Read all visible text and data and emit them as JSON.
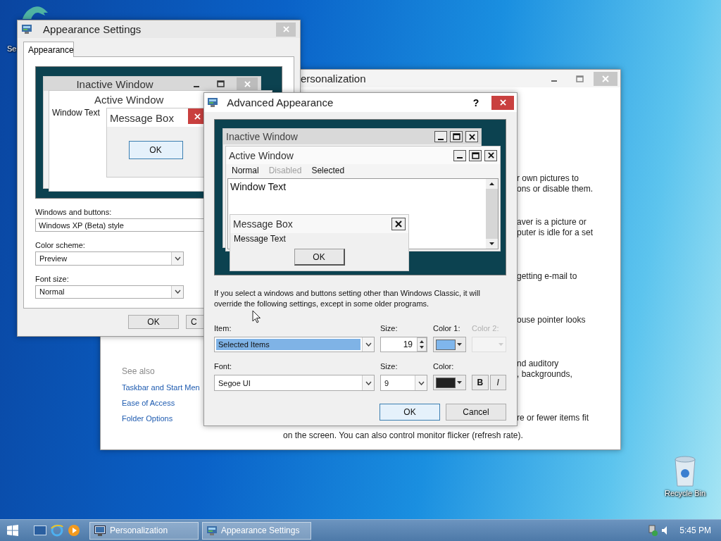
{
  "desktop": {
    "icons": [
      {
        "label": "Se",
        "kind": "dragon"
      },
      {
        "label": "Recycle Bin",
        "kind": "bin"
      }
    ]
  },
  "personalization": {
    "title": "ersonalization",
    "see_also": {
      "heading": "See also",
      "links": [
        "Taskbar and Start Men",
        "Ease of Access",
        "Folder Options"
      ]
    },
    "fragments": [
      [
        "r own pictures to",
        "ons or disable them."
      ],
      [
        "aver is a picture or",
        "puter is idle for a set"
      ],
      [
        "getting e-mail to"
      ],
      [
        "ouse pointer looks"
      ],
      [
        "nd auditory",
        ", backgrounds,"
      ],
      [
        "re or fewer items fit"
      ]
    ],
    "last_line": "on the screen. You can also control monitor flicker (refresh rate)."
  },
  "appearance_settings": {
    "title": "Appearance Settings",
    "tabs": [
      {
        "label": "Appearance",
        "selected": true
      }
    ],
    "preview": {
      "inactive_title": "Inactive Window",
      "active_title": "Active Window",
      "window_text": "Window Text",
      "message_box_title": "Message Box",
      "ok": "OK"
    },
    "fields": [
      {
        "label": "Windows and buttons:",
        "value": "Windows XP (Beta) style",
        "kind": "text"
      },
      {
        "label": "Color scheme:",
        "value": "Preview",
        "kind": "dropdown"
      },
      {
        "label": "Font size:",
        "value": "Normal",
        "kind": "dropdown"
      }
    ],
    "buttons": [
      "OK",
      "C"
    ]
  },
  "advanced_appearance": {
    "title": "Advanced Appearance",
    "help": "?",
    "preview": {
      "inactive_title": "Inactive Window",
      "active_title": "Active Window",
      "menu": [
        {
          "label": "Normal",
          "disabled": false
        },
        {
          "label": "Disabled",
          "disabled": true
        },
        {
          "label": "Selected",
          "disabled": false
        }
      ],
      "window_text": "Window Text",
      "message_box_title": "Message Box",
      "message_text": "Message Text",
      "ok": "OK"
    },
    "note": "If you select a windows and buttons setting other than Windows Classic, it will override the following settings, except in some older programs.",
    "item": {
      "label": "Item:",
      "value": "Selected Items"
    },
    "item_size": {
      "label": "Size:",
      "value": "19"
    },
    "color1": {
      "label": "Color 1:",
      "color": "#7fb6ec",
      "disabled": false
    },
    "color2": {
      "label": "Color 2:",
      "disabled": true
    },
    "font": {
      "label": "Font:",
      "value": "Segoe UI"
    },
    "font_size": {
      "label": "Size:",
      "value": "9"
    },
    "font_color": {
      "label": "Color:",
      "color": "#222222"
    },
    "bold": "B",
    "italic": "I",
    "buttons": [
      {
        "label": "OK",
        "default": true
      },
      {
        "label": "Cancel",
        "default": false
      }
    ]
  },
  "taskbar": {
    "tasks": [
      {
        "label": "Personalization",
        "kind": "monitor"
      },
      {
        "label": "Appearance Settings",
        "kind": "settings"
      }
    ],
    "clock": "5:45 PM"
  }
}
